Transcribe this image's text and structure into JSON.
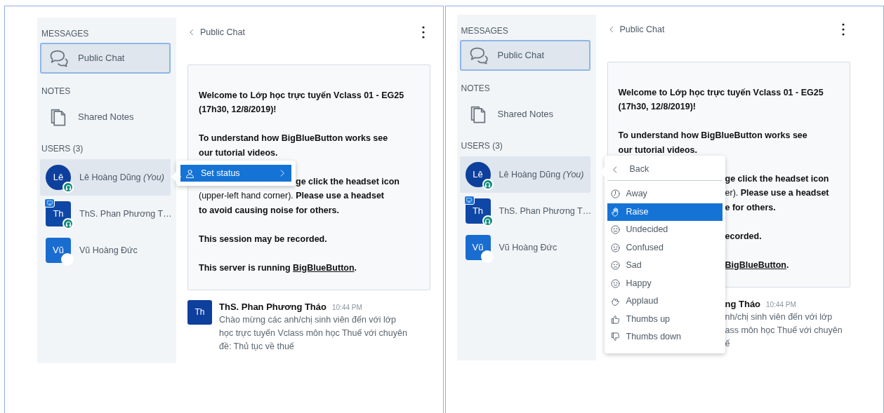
{
  "panels": [
    {
      "sidebar": {
        "messages_heading": "MESSAGES",
        "public_chat": {
          "label": "Public Chat",
          "selected": true
        },
        "notes_heading": "NOTES",
        "shared_notes": {
          "label": "Shared Notes",
          "selected": false
        },
        "users_heading": "USERS (3)",
        "users": [
          {
            "initials": "Lê",
            "name": "Lê Hoàng Dũng",
            "you": "(You)",
            "round": true,
            "color": "#0d3f9c",
            "selected": true,
            "presenter": false,
            "headset": true,
            "blank_badge": false
          },
          {
            "initials": "Th",
            "name": "ThS. Phan Phương T…",
            "round": false,
            "color": "#0f47a6",
            "selected": false,
            "presenter": true,
            "headset": true,
            "blank_badge": false
          },
          {
            "initials": "Vũ",
            "name": "Vũ Hoàng Đức",
            "round": false,
            "color": "#1a6dd0",
            "selected": false,
            "presenter": false,
            "headset": false,
            "blank_badge": true
          }
        ]
      },
      "chat": {
        "title": "Public Chat",
        "welcome": [
          [
            {
              "text": "Welcome to Lớp học trực tuyến Vclass 01 - EG25"
            },
            {
              "text": "(17h30, 12/8/2019)!"
            }
          ],
          [
            {
              "text": "To understand how BigBlueButton works see"
            },
            {
              "text": "our tutorial videos."
            }
          ],
          [
            {
              "text": "ge click the headset icon",
              "covered": true
            },
            {
              "text": "(upper-left hand corner). **Please use a headset**"
            },
            {
              "text": "to avoid causing noise for others."
            }
          ],
          [
            {
              "text": "This session may be recorded."
            }
          ],
          [
            {
              "text": "This server is running ",
              "link": "BigBlueButton",
              "end": "."
            }
          ]
        ],
        "message": {
          "initials": "Th",
          "sender": "ThS. Phan Phương Tháo",
          "time": "10:44 PM",
          "covered": false,
          "lines": [
            "Chào mừng các anh/chị sinh viên đến với lớp",
            "học trực tuyến Vclass môn học Thuế với chuyên",
            "đề: Thủ tục về thuế"
          ]
        }
      },
      "menu": {
        "kind": "user",
        "item": {
          "label": "Set status",
          "selected": true
        }
      }
    },
    {
      "sidebar": {
        "messages_heading": "MESSAGES",
        "public_chat": {
          "label": "Public Chat",
          "selected": true
        },
        "notes_heading": "NOTES",
        "shared_notes": {
          "label": "Shared Notes",
          "selected": false
        },
        "users_heading": "USERS (3)",
        "users": [
          {
            "initials": "Lê",
            "name": "Lê Hoàng Dũng",
            "you": "(You)",
            "round": true,
            "color": "#0d3f9c",
            "selected": true,
            "presenter": false,
            "headset": true,
            "blank_badge": false
          },
          {
            "initials": "Th",
            "name": "ThS. Phan Phương T…",
            "round": false,
            "color": "#0f47a6",
            "selected": false,
            "presenter": true,
            "headset": true,
            "blank_badge": false
          },
          {
            "initials": "Vũ",
            "name": "Vũ Hoàng Đức",
            "round": false,
            "color": "#1a6dd0",
            "selected": false,
            "presenter": false,
            "headset": false,
            "blank_badge": true
          }
        ]
      },
      "chat": {
        "title": "Public Chat",
        "welcome": [
          [
            {
              "text": "Welcome to Lớp học trực tuyến Vclass 01 - EG25"
            },
            {
              "text": "(17h30, 12/8/2019)!"
            }
          ],
          [
            {
              "text": "To understand how BigBlueButton works see"
            },
            {
              "text": "our tutorial videos."
            }
          ],
          [
            {
              "text": "ge click the headset icon",
              "covered": true
            },
            {
              "text": "er). **Please use a headset**",
              "covered": true
            },
            {
              "text": "e for others.",
              "covered": true
            }
          ],
          [
            {
              "text": "ecorded.",
              "covered": true
            }
          ],
          [
            {
              "link": "BigBlueButton",
              "end": ".",
              "covered": true
            }
          ]
        ],
        "message": {
          "sender": "ng Tháo",
          "time": "10:44 PM",
          "covered": true,
          "lines": [
            "nh/chị sinh viên đến với lớp",
            "ass môn học Thuế với chuyên",
            "ế"
          ]
        }
      },
      "menu": {
        "kind": "status",
        "back": "Back",
        "items": [
          {
            "label": "Away",
            "selected": false
          },
          {
            "label": "Raise",
            "selected": true
          },
          {
            "label": "Undecided",
            "selected": false
          },
          {
            "label": "Confused",
            "selected": false
          },
          {
            "label": "Sad",
            "selected": false
          },
          {
            "label": "Happy",
            "selected": false
          },
          {
            "label": "Applaud",
            "selected": false
          },
          {
            "label": "Thumbs up",
            "selected": false
          },
          {
            "label": "Thumbs down",
            "selected": false
          }
        ]
      }
    }
  ]
}
